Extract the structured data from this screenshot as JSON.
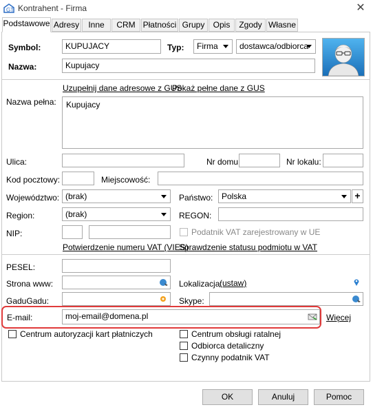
{
  "window": {
    "title": "Kontrahent - Firma",
    "close": "✕"
  },
  "tabs": [
    "Podstawowe",
    "Adresy",
    "Inne",
    "CRM",
    "Płatności",
    "Grupy",
    "Opis",
    "Zgody",
    "Własne"
  ],
  "form": {
    "symbol_label": "Symbol:",
    "symbol_value": "KUPUJACY",
    "typ_label": "Typ:",
    "typ_value": "Firma",
    "typ2_value": "dostawca/odbiorca",
    "nazwa_label": "Nazwa:",
    "nazwa_value": "Kupujacy",
    "link_gus": "Uzupełnij dane adresowe z GUS",
    "link_gus_full": "Pokaż pełne dane z GUS",
    "nazwa_pelna_label": "Nazwa pełna:",
    "nazwa_pelna_value": "Kupujacy",
    "ulica_label": "Ulica:",
    "nr_domu_label": "Nr domu:",
    "nr_lokalu_label": "Nr lokalu:",
    "kod_label": "Kod pocztowy:",
    "miejscowosc_label": "Miejscowość:",
    "woj_label": "Województwo:",
    "woj_value": "(brak)",
    "panstwo_label": "Państwo:",
    "panstwo_value": "Polska",
    "plus": "+",
    "region_label": "Region:",
    "region_value": "(brak)",
    "regon_label": "REGON:",
    "nip_label": "NIP:",
    "vat_ue_label": "Podatnik VAT zarejestrowany w UE",
    "link_vies": "Potwierdzenie numeru VAT (VIES)",
    "link_vat_status": "Sprawdzenie statusu podmiotu w VAT",
    "pesel_label": "PESEL:",
    "www_label": "Strona www:",
    "lokalizacja_label": "Lokalizacja:",
    "lokalizacja_link": "(ustaw)",
    "gadugadu_label": "GaduGadu:",
    "skype_label": "Skype:",
    "email_label": "E-mail:",
    "email_value": "moj-email@domena.pl",
    "wiecej_link": "Więcej",
    "cb_karty": "Centrum autoryzacji kart płatniczych",
    "cb_ratalnej": "Centrum obsługi ratalnej",
    "cb_detaliczny": "Odbiorca detaliczny",
    "cb_czynny_vat": "Czynny podatnik VAT"
  },
  "buttons": {
    "ok": "OK",
    "cancel": "Anuluj",
    "help": "Pomoc"
  },
  "colors": {
    "accent_red": "#e03a3a",
    "title_icon_blue": "#2b6cc4"
  }
}
